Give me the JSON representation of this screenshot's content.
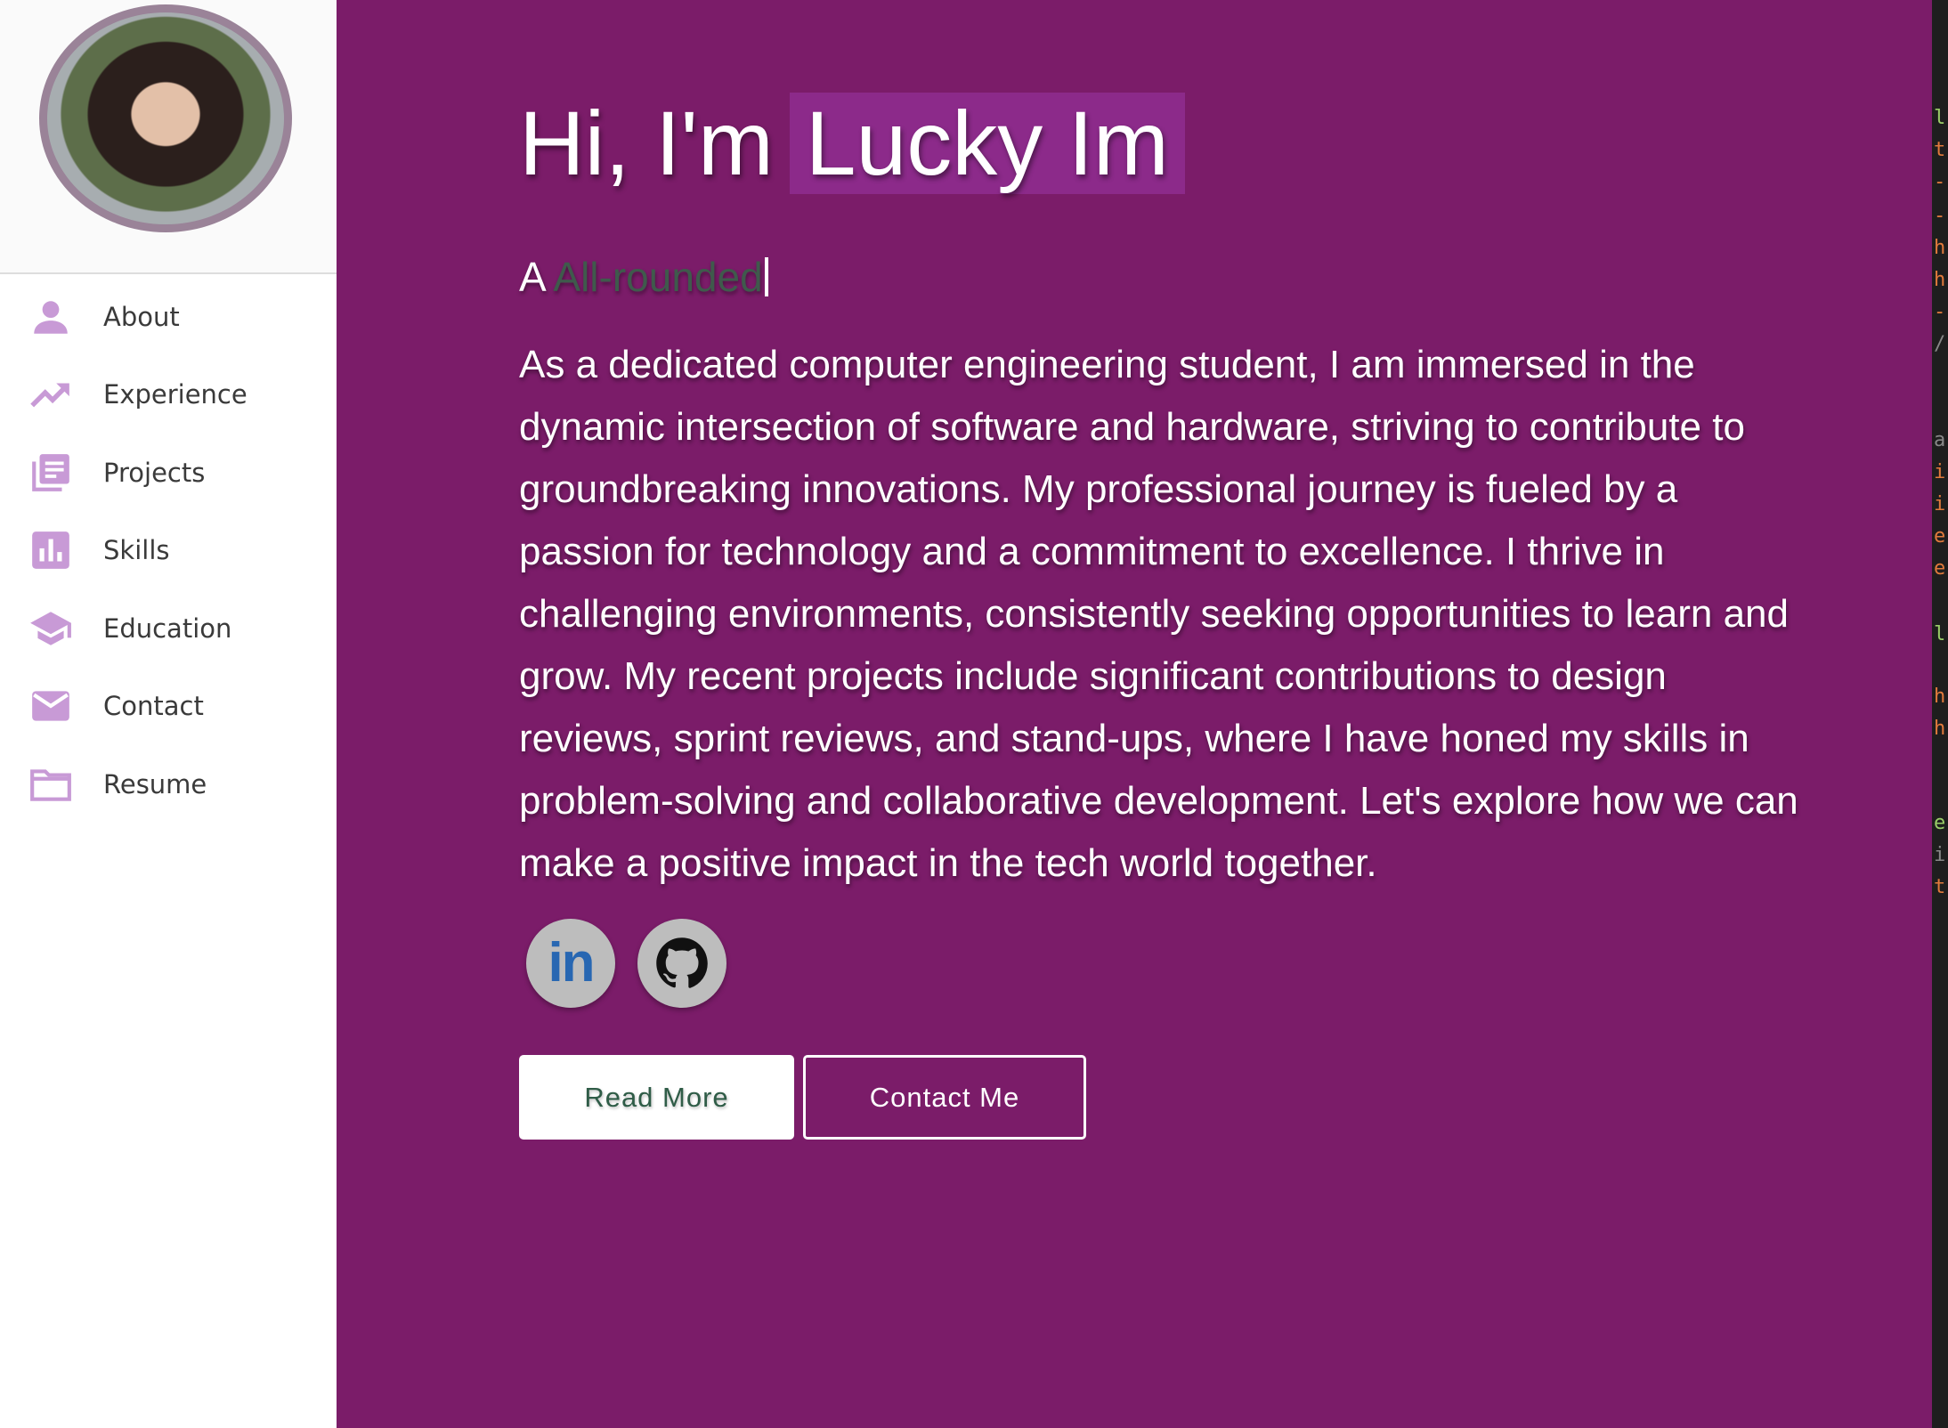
{
  "sidebar": {
    "items": [
      {
        "label": "About",
        "icon": "person-icon"
      },
      {
        "label": "Experience",
        "icon": "trending-up-icon"
      },
      {
        "label": "Projects",
        "icon": "library-books-icon"
      },
      {
        "label": "Skills",
        "icon": "bar-chart-icon"
      },
      {
        "label": "Education",
        "icon": "graduation-cap-icon"
      },
      {
        "label": "Contact",
        "icon": "mail-icon"
      },
      {
        "label": "Resume",
        "icon": "folder-icon"
      }
    ]
  },
  "hero": {
    "greeting_prefix": "Hi, I'm",
    "name": "Lucky Im",
    "subtitle_prefix": "A",
    "typed_word": "All-rounded",
    "bio": "As a dedicated computer engineering student, I am immersed in the dynamic intersection of software and hardware, striving to contribute to groundbreaking innovations. My professional journey is fueled by a passion for technology and a commitment to excellence. I thrive in challenging environments, consistently seeking opportunities to learn and grow. My recent projects include significant contributions to design reviews, sprint reviews, and stand-ups, where I have honed my skills in problem-solving and collaborative development. Let's explore how we can make a positive impact in the tech world together."
  },
  "social": {
    "linkedin_label": "in"
  },
  "buttons": {
    "read_more": "Read More",
    "contact_me": "Contact Me"
  },
  "colors": {
    "main_background": "#7b1c69",
    "name_highlight": "#8c2a8a",
    "icon_color": "#c89ad6",
    "sidebar_background": "#ffffff",
    "linkedin_blue": "#2867b2"
  }
}
